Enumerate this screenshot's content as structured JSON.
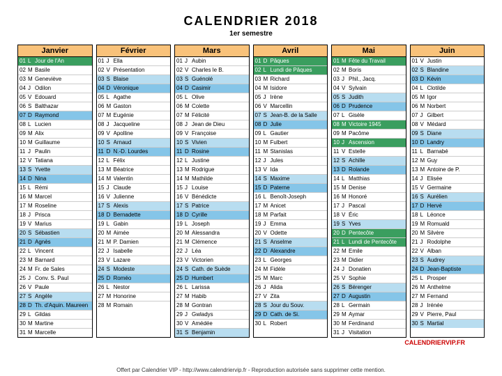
{
  "title": "CALENDRIER 2018",
  "subtitle": "1er semestre",
  "footer_right": "CALENDRIERVIP.FR",
  "footer_center": "Offert par Calendrier VIP - http://www.calendriervip.fr - Reproduction autorisée sans supprimer cette mention.",
  "months": [
    {
      "name": "Janvier",
      "days": [
        {
          "n": "01",
          "d": "L",
          "t": "Jour de l'An",
          "c": "hl-green"
        },
        {
          "n": "02",
          "d": "M",
          "t": "Basile"
        },
        {
          "n": "03",
          "d": "M",
          "t": "Geneviève"
        },
        {
          "n": "04",
          "d": "J",
          "t": "Odilon"
        },
        {
          "n": "05",
          "d": "V",
          "t": "Edouard"
        },
        {
          "n": "06",
          "d": "S",
          "t": "Balthazar"
        },
        {
          "n": "07",
          "d": "D",
          "t": "Raymond",
          "c": "hl-blue"
        },
        {
          "n": "08",
          "d": "L",
          "t": "Lucien"
        },
        {
          "n": "09",
          "d": "M",
          "t": "Alix"
        },
        {
          "n": "10",
          "d": "M",
          "t": "Guillaume"
        },
        {
          "n": "11",
          "d": "J",
          "t": "Paulin"
        },
        {
          "n": "12",
          "d": "V",
          "t": "Tatiana"
        },
        {
          "n": "13",
          "d": "S",
          "t": "Yvette",
          "c": "hl-lblue"
        },
        {
          "n": "14",
          "d": "D",
          "t": "Nina",
          "c": "hl-blue"
        },
        {
          "n": "15",
          "d": "L",
          "t": "Rémi"
        },
        {
          "n": "16",
          "d": "M",
          "t": "Marcel"
        },
        {
          "n": "17",
          "d": "M",
          "t": "Roseline"
        },
        {
          "n": "18",
          "d": "J",
          "t": "Prisca"
        },
        {
          "n": "19",
          "d": "V",
          "t": "Marius"
        },
        {
          "n": "20",
          "d": "S",
          "t": "Sébastien",
          "c": "hl-lblue"
        },
        {
          "n": "21",
          "d": "D",
          "t": "Agnès",
          "c": "hl-blue"
        },
        {
          "n": "22",
          "d": "L",
          "t": "Vincent"
        },
        {
          "n": "23",
          "d": "M",
          "t": "Barnard"
        },
        {
          "n": "24",
          "d": "M",
          "t": "Fr. de Sales"
        },
        {
          "n": "25",
          "d": "J",
          "t": "Conv. S. Paul"
        },
        {
          "n": "26",
          "d": "V",
          "t": "Paule"
        },
        {
          "n": "27",
          "d": "S",
          "t": "Angèle",
          "c": "hl-lblue"
        },
        {
          "n": "28",
          "d": "D",
          "t": "Th. d'Aquin. Maureen",
          "c": "hl-blue"
        },
        {
          "n": "29",
          "d": "L",
          "t": "Gildas"
        },
        {
          "n": "30",
          "d": "M",
          "t": "Martine"
        },
        {
          "n": "31",
          "d": "M",
          "t": "Marcelle"
        }
      ]
    },
    {
      "name": "Février",
      "days": [
        {
          "n": "01",
          "d": "J",
          "t": "Ella"
        },
        {
          "n": "02",
          "d": "V",
          "t": "Présentation"
        },
        {
          "n": "03",
          "d": "S",
          "t": "Blaise",
          "c": "hl-lblue"
        },
        {
          "n": "04",
          "d": "D",
          "t": "Véronique",
          "c": "hl-blue"
        },
        {
          "n": "05",
          "d": "L",
          "t": "Agathe"
        },
        {
          "n": "06",
          "d": "M",
          "t": "Gaston"
        },
        {
          "n": "07",
          "d": "M",
          "t": "Eugénie"
        },
        {
          "n": "08",
          "d": "J",
          "t": "Jacqueline"
        },
        {
          "n": "09",
          "d": "V",
          "t": "Apolline"
        },
        {
          "n": "10",
          "d": "S",
          "t": "Arnaud",
          "c": "hl-lblue"
        },
        {
          "n": "11",
          "d": "D",
          "t": "N.-D. Lourdes",
          "c": "hl-blue"
        },
        {
          "n": "12",
          "d": "L",
          "t": "Félix"
        },
        {
          "n": "13",
          "d": "M",
          "t": "Béatrice"
        },
        {
          "n": "14",
          "d": "M",
          "t": "Valentin"
        },
        {
          "n": "15",
          "d": "J",
          "t": "Claude"
        },
        {
          "n": "16",
          "d": "V",
          "t": "Julienne"
        },
        {
          "n": "17",
          "d": "S",
          "t": "Alexis",
          "c": "hl-lblue"
        },
        {
          "n": "18",
          "d": "D",
          "t": "Bernadette",
          "c": "hl-blue"
        },
        {
          "n": "19",
          "d": "L",
          "t": "Gabin"
        },
        {
          "n": "20",
          "d": "M",
          "t": "Aimée"
        },
        {
          "n": "21",
          "d": "M",
          "t": "P. Damien"
        },
        {
          "n": "22",
          "d": "J",
          "t": "Isabelle"
        },
        {
          "n": "23",
          "d": "V",
          "t": "Lazare"
        },
        {
          "n": "24",
          "d": "S",
          "t": "Modeste",
          "c": "hl-lblue"
        },
        {
          "n": "25",
          "d": "D",
          "t": "Roméo",
          "c": "hl-blue"
        },
        {
          "n": "26",
          "d": "L",
          "t": "Nestor"
        },
        {
          "n": "27",
          "d": "M",
          "t": "Honorine"
        },
        {
          "n": "28",
          "d": "M",
          "t": "Romain"
        }
      ]
    },
    {
      "name": "Mars",
      "days": [
        {
          "n": "01",
          "d": "J",
          "t": "Aubin"
        },
        {
          "n": "02",
          "d": "V",
          "t": "Charles le B."
        },
        {
          "n": "03",
          "d": "S",
          "t": "Guénolé",
          "c": "hl-lblue"
        },
        {
          "n": "04",
          "d": "D",
          "t": "Casimir",
          "c": "hl-blue"
        },
        {
          "n": "05",
          "d": "L",
          "t": "Olive"
        },
        {
          "n": "06",
          "d": "M",
          "t": "Colette"
        },
        {
          "n": "07",
          "d": "M",
          "t": "Félicité"
        },
        {
          "n": "08",
          "d": "J",
          "t": "Jean de Dieu"
        },
        {
          "n": "09",
          "d": "V",
          "t": "Françoise"
        },
        {
          "n": "10",
          "d": "S",
          "t": "Vivien",
          "c": "hl-lblue"
        },
        {
          "n": "11",
          "d": "D",
          "t": "Rosine",
          "c": "hl-blue"
        },
        {
          "n": "12",
          "d": "L",
          "t": "Justine"
        },
        {
          "n": "13",
          "d": "M",
          "t": "Rodrigue"
        },
        {
          "n": "14",
          "d": "M",
          "t": "Mathilde"
        },
        {
          "n": "15",
          "d": "J",
          "t": "Louise"
        },
        {
          "n": "16",
          "d": "V",
          "t": "Bénédicte"
        },
        {
          "n": "17",
          "d": "S",
          "t": "Patrice",
          "c": "hl-lblue"
        },
        {
          "n": "18",
          "d": "D",
          "t": "Cyrille",
          "c": "hl-blue"
        },
        {
          "n": "19",
          "d": "L",
          "t": "Joseph"
        },
        {
          "n": "20",
          "d": "M",
          "t": "Alessandra"
        },
        {
          "n": "21",
          "d": "M",
          "t": "Clémence"
        },
        {
          "n": "22",
          "d": "J",
          "t": "Léa"
        },
        {
          "n": "23",
          "d": "V",
          "t": "Victorien"
        },
        {
          "n": "24",
          "d": "S",
          "t": "Cath. de Suède",
          "c": "hl-lblue"
        },
        {
          "n": "25",
          "d": "D",
          "t": "Humbert",
          "c": "hl-blue"
        },
        {
          "n": "26",
          "d": "L",
          "t": "Larissa"
        },
        {
          "n": "27",
          "d": "M",
          "t": "Habib"
        },
        {
          "n": "28",
          "d": "M",
          "t": "Gontran"
        },
        {
          "n": "29",
          "d": "J",
          "t": "Gwladys"
        },
        {
          "n": "30",
          "d": "V",
          "t": "Amédée"
        },
        {
          "n": "31",
          "d": "S",
          "t": "Benjamin",
          "c": "hl-lblue"
        }
      ]
    },
    {
      "name": "Avril",
      "days": [
        {
          "n": "01",
          "d": "D",
          "t": "Pâques",
          "c": "hl-green"
        },
        {
          "n": "02",
          "d": "L",
          "t": "Lundi de Pâques",
          "c": "hl-green"
        },
        {
          "n": "03",
          "d": "M",
          "t": "Richard"
        },
        {
          "n": "04",
          "d": "M",
          "t": "Isidore"
        },
        {
          "n": "05",
          "d": "J",
          "t": "Irène"
        },
        {
          "n": "06",
          "d": "V",
          "t": "Marcellin"
        },
        {
          "n": "07",
          "d": "S",
          "t": "Jean-B. de la Salle",
          "c": "hl-lblue"
        },
        {
          "n": "08",
          "d": "D",
          "t": "Julie",
          "c": "hl-blue"
        },
        {
          "n": "09",
          "d": "L",
          "t": "Gautier"
        },
        {
          "n": "10",
          "d": "M",
          "t": "Fulbert"
        },
        {
          "n": "11",
          "d": "M",
          "t": "Stanislas"
        },
        {
          "n": "12",
          "d": "J",
          "t": "Jules"
        },
        {
          "n": "13",
          "d": "V",
          "t": "Ida"
        },
        {
          "n": "14",
          "d": "S",
          "t": "Maxime",
          "c": "hl-lblue"
        },
        {
          "n": "15",
          "d": "D",
          "t": "Paterne",
          "c": "hl-blue"
        },
        {
          "n": "16",
          "d": "L",
          "t": "Benoît-Joseph"
        },
        {
          "n": "17",
          "d": "M",
          "t": "Anicet"
        },
        {
          "n": "18",
          "d": "M",
          "t": "Parfait"
        },
        {
          "n": "19",
          "d": "J",
          "t": "Emma"
        },
        {
          "n": "20",
          "d": "V",
          "t": "Odette"
        },
        {
          "n": "21",
          "d": "S",
          "t": "Anselme",
          "c": "hl-lblue"
        },
        {
          "n": "22",
          "d": "D",
          "t": "Alexandre",
          "c": "hl-blue"
        },
        {
          "n": "23",
          "d": "L",
          "t": "Georges"
        },
        {
          "n": "24",
          "d": "M",
          "t": "Fidèle"
        },
        {
          "n": "25",
          "d": "M",
          "t": "Marc"
        },
        {
          "n": "26",
          "d": "J",
          "t": "Alida"
        },
        {
          "n": "27",
          "d": "V",
          "t": "Zita"
        },
        {
          "n": "28",
          "d": "S",
          "t": "Jour du Souv.",
          "c": "hl-lblue"
        },
        {
          "n": "29",
          "d": "D",
          "t": "Cath. de Si.",
          "c": "hl-blue"
        },
        {
          "n": "30",
          "d": "L",
          "t": "Robert"
        }
      ]
    },
    {
      "name": "Mai",
      "days": [
        {
          "n": "01",
          "d": "M",
          "t": "Fête du Travail",
          "c": "hl-green"
        },
        {
          "n": "02",
          "d": "M",
          "t": "Boris"
        },
        {
          "n": "03",
          "d": "J",
          "t": "Phil., Jacq."
        },
        {
          "n": "04",
          "d": "V",
          "t": "Sylvain"
        },
        {
          "n": "05",
          "d": "S",
          "t": "Judith",
          "c": "hl-lblue"
        },
        {
          "n": "06",
          "d": "D",
          "t": "Prudence",
          "c": "hl-blue"
        },
        {
          "n": "07",
          "d": "L",
          "t": "Gisèle"
        },
        {
          "n": "08",
          "d": "M",
          "t": "Victoire 1945",
          "c": "hl-green"
        },
        {
          "n": "09",
          "d": "M",
          "t": "Pacôme"
        },
        {
          "n": "10",
          "d": "J",
          "t": "Ascension",
          "c": "hl-green"
        },
        {
          "n": "11",
          "d": "V",
          "t": "Estelle"
        },
        {
          "n": "12",
          "d": "S",
          "t": "Achille",
          "c": "hl-lblue"
        },
        {
          "n": "13",
          "d": "D",
          "t": "Rolande",
          "c": "hl-blue"
        },
        {
          "n": "14",
          "d": "L",
          "t": "Matthias"
        },
        {
          "n": "15",
          "d": "M",
          "t": "Denise"
        },
        {
          "n": "16",
          "d": "M",
          "t": "Honoré"
        },
        {
          "n": "17",
          "d": "J",
          "t": "Pascal"
        },
        {
          "n": "18",
          "d": "V",
          "t": "Éric"
        },
        {
          "n": "19",
          "d": "S",
          "t": "Yves",
          "c": "hl-lblue"
        },
        {
          "n": "20",
          "d": "D",
          "t": "Pentecôte",
          "c": "hl-green"
        },
        {
          "n": "21",
          "d": "L",
          "t": "Lundi de Pentecôte",
          "c": "hl-green"
        },
        {
          "n": "22",
          "d": "M",
          "t": "Emile"
        },
        {
          "n": "23",
          "d": "M",
          "t": "Didier"
        },
        {
          "n": "24",
          "d": "J",
          "t": "Donatien"
        },
        {
          "n": "25",
          "d": "V",
          "t": "Sophie"
        },
        {
          "n": "26",
          "d": "S",
          "t": "Bérenger",
          "c": "hl-lblue"
        },
        {
          "n": "27",
          "d": "D",
          "t": "Augustin",
          "c": "hl-blue"
        },
        {
          "n": "28",
          "d": "L",
          "t": "Germain"
        },
        {
          "n": "29",
          "d": "M",
          "t": "Aymar"
        },
        {
          "n": "30",
          "d": "M",
          "t": "Ferdinand"
        },
        {
          "n": "31",
          "d": "J",
          "t": "Visitation"
        }
      ]
    },
    {
      "name": "Juin",
      "days": [
        {
          "n": "01",
          "d": "V",
          "t": "Justin"
        },
        {
          "n": "02",
          "d": "S",
          "t": "Blandine",
          "c": "hl-lblue"
        },
        {
          "n": "03",
          "d": "D",
          "t": "Kévin",
          "c": "hl-blue"
        },
        {
          "n": "04",
          "d": "L",
          "t": "Clotilde"
        },
        {
          "n": "05",
          "d": "M",
          "t": "Igor"
        },
        {
          "n": "06",
          "d": "M",
          "t": "Norbert"
        },
        {
          "n": "07",
          "d": "J",
          "t": "Gilbert"
        },
        {
          "n": "08",
          "d": "V",
          "t": "Médard"
        },
        {
          "n": "09",
          "d": "S",
          "t": "Diane",
          "c": "hl-lblue"
        },
        {
          "n": "10",
          "d": "D",
          "t": "Landry",
          "c": "hl-blue"
        },
        {
          "n": "11",
          "d": "L",
          "t": "Barnabé"
        },
        {
          "n": "12",
          "d": "M",
          "t": "Guy"
        },
        {
          "n": "13",
          "d": "M",
          "t": "Antoine de P."
        },
        {
          "n": "14",
          "d": "J",
          "t": "Elisée"
        },
        {
          "n": "15",
          "d": "V",
          "t": "Germaine"
        },
        {
          "n": "16",
          "d": "S",
          "t": "Aurélien",
          "c": "hl-lblue"
        },
        {
          "n": "17",
          "d": "D",
          "t": "Hervé",
          "c": "hl-blue"
        },
        {
          "n": "18",
          "d": "L",
          "t": "Léonce"
        },
        {
          "n": "19",
          "d": "M",
          "t": "Romuald"
        },
        {
          "n": "20",
          "d": "M",
          "t": "Silvère"
        },
        {
          "n": "21",
          "d": "J",
          "t": "Rodolphe"
        },
        {
          "n": "22",
          "d": "V",
          "t": "Alban"
        },
        {
          "n": "23",
          "d": "S",
          "t": "Audrey",
          "c": "hl-lblue"
        },
        {
          "n": "24",
          "d": "D",
          "t": "Jean-Baptiste",
          "c": "hl-blue"
        },
        {
          "n": "25",
          "d": "L",
          "t": "Prosper"
        },
        {
          "n": "26",
          "d": "M",
          "t": "Anthelme"
        },
        {
          "n": "27",
          "d": "M",
          "t": "Fernand"
        },
        {
          "n": "28",
          "d": "J",
          "t": "Irénée"
        },
        {
          "n": "29",
          "d": "V",
          "t": "Pierre, Paul"
        },
        {
          "n": "30",
          "d": "S",
          "t": "Martial",
          "c": "hl-lblue"
        }
      ]
    }
  ]
}
